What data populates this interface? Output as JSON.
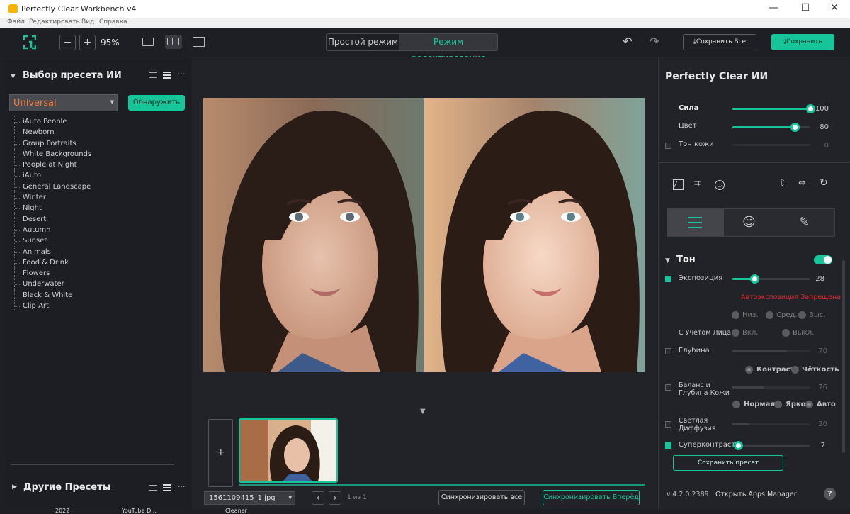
{
  "window": {
    "title": "Perfectly Clear Workbench v4",
    "controls": [
      "—",
      "☐",
      "✕"
    ]
  },
  "menu": [
    "Файл",
    "Редактировать",
    "Вид",
    "Справка"
  ],
  "toolbar": {
    "minus": "−",
    "plus": "+",
    "zoom": "95%",
    "mode_simple": "Простой режим",
    "mode_edit": "Режим редактирования",
    "undo": "↶",
    "redo": "↷",
    "save_all": "Сохранить Все",
    "save": "Сохранить",
    "download_glyph": "⤓"
  },
  "left": {
    "ai_preset_title": "Выбор пресета ИИ",
    "dropdown_value": "Universal",
    "detect_button": "Обнаружить",
    "presets": [
      "iAuto People",
      "Newborn",
      "Group Portraits",
      "White Backgrounds",
      "People at Night",
      "iAuto",
      "General Landscape",
      "Winter",
      "Night",
      "Desert",
      "Autumn",
      "Sunset",
      "Animals",
      "Food & Drink",
      "Flowers",
      "Underwater",
      "Black & White",
      "Clip Art"
    ],
    "other_presets": "Другие Пресеты",
    "more": "···"
  },
  "center": {
    "add": "+",
    "filename": "1561109415_1.jpg",
    "page": "1 из 1",
    "prev": "‹",
    "next": "›",
    "sync_all": "Синхронизировать все",
    "sync_forward": "Синхронизировать Вперёд",
    "down_arrow": "▼"
  },
  "right": {
    "title": "Perfectly Clear ИИ",
    "strength": {
      "label": "Сила",
      "value": "100",
      "level": 100
    },
    "color": {
      "label": "Цвет",
      "value": "80",
      "level": 80
    },
    "skin_tone": {
      "label": "Тон кожи",
      "value": "0",
      "level": 0
    },
    "tone_title": "Тон",
    "exposure": {
      "label": "Экспозиция",
      "value": "28",
      "level": 28
    },
    "auto_exposure_note": "Автоэкспозиция Запрещена",
    "exp_low": "Низ.",
    "exp_mid": "Сред.",
    "exp_high": "Выс.",
    "face_aware": "С Учетом Лица",
    "on": "Вкл.",
    "off": "Выкл.",
    "depth": {
      "label": "Глубина",
      "value": "70",
      "level": 70
    },
    "contrast": "Контраст",
    "clarity": "Чёткость",
    "skin_balance_1": "Баланс и",
    "skin_balance_2": "Глубина Кожи",
    "skin_balance": {
      "value": "76",
      "level": 40
    },
    "normal": "Нормаль",
    "bright": "Ярко",
    "auto": "Авто",
    "light_diffusion_1": "Светлая",
    "light_diffusion_2": "Диффузия",
    "light_diffusion": {
      "value": "20",
      "level": 20
    },
    "supercontrast": {
      "label": "Суперконтраст",
      "value": "7",
      "level": 7
    },
    "save_preset": "Сохранить пресет",
    "version": "v:4.2.0.2389",
    "apps_manager": "Открыть Apps Manager",
    "help": "?"
  },
  "desktop": {
    "l1": "2022",
    "l2": "YouTube D...",
    "l3": "Cleaner"
  },
  "accent": "#17c59a",
  "warning_color": "#e0262a"
}
